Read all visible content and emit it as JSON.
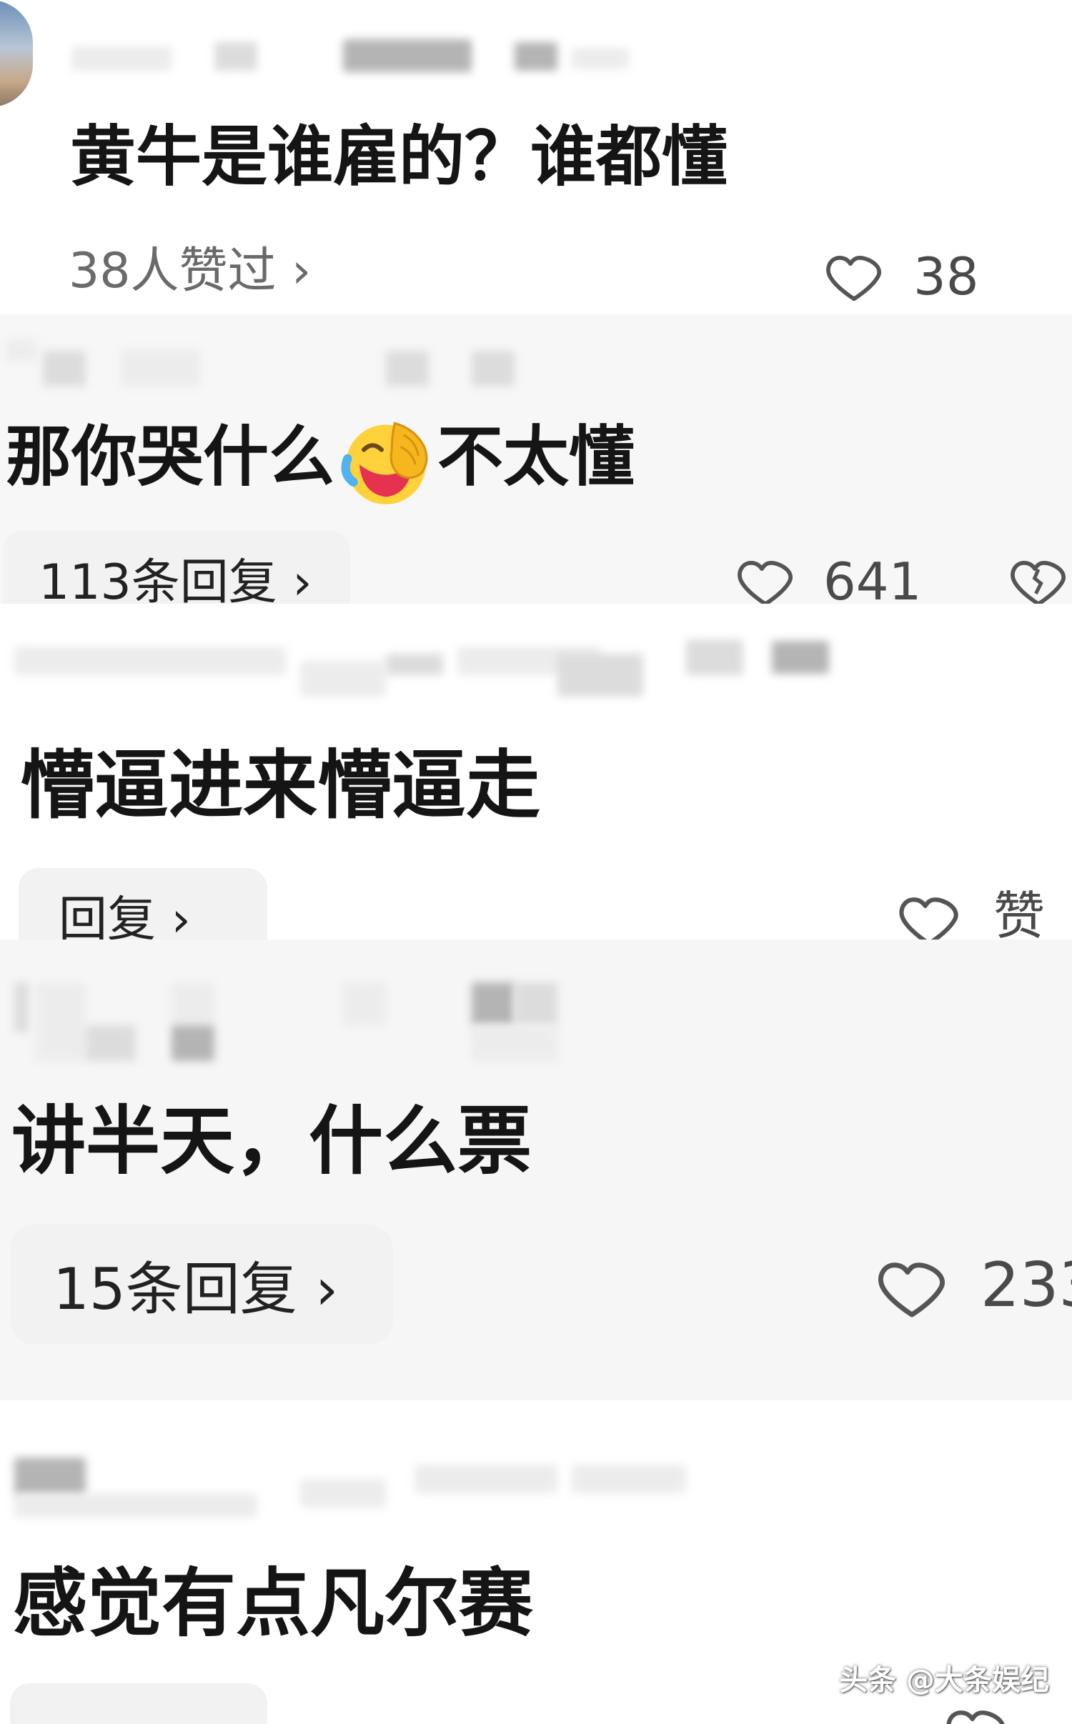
{
  "comments": [
    {
      "text": "黄牛是谁雇的？谁都懂",
      "likes_summary": "38人赞过 ›",
      "like_count": "38"
    },
    {
      "text_before": "那你哭什么",
      "emoji": "laughing-crying-face-icon",
      "text_after": "不太懂",
      "reply_label": "113条回复 ›",
      "like_count": "641"
    },
    {
      "text": "懵逼进来懵逼走",
      "reply_label": "回复 ›",
      "like_label": "赞"
    },
    {
      "text": "讲半天，什么票",
      "reply_label": "15条回复 ›",
      "like_count": "233"
    },
    {
      "text": "感觉有点凡尔赛"
    }
  ],
  "watermark": "头条 @大条娱纪",
  "colors": {
    "background": "#ffffff",
    "text": "#151515",
    "muted": "#4a4a4a",
    "pill": "#f2f2f2",
    "section_gray": "#f7f7f7"
  }
}
